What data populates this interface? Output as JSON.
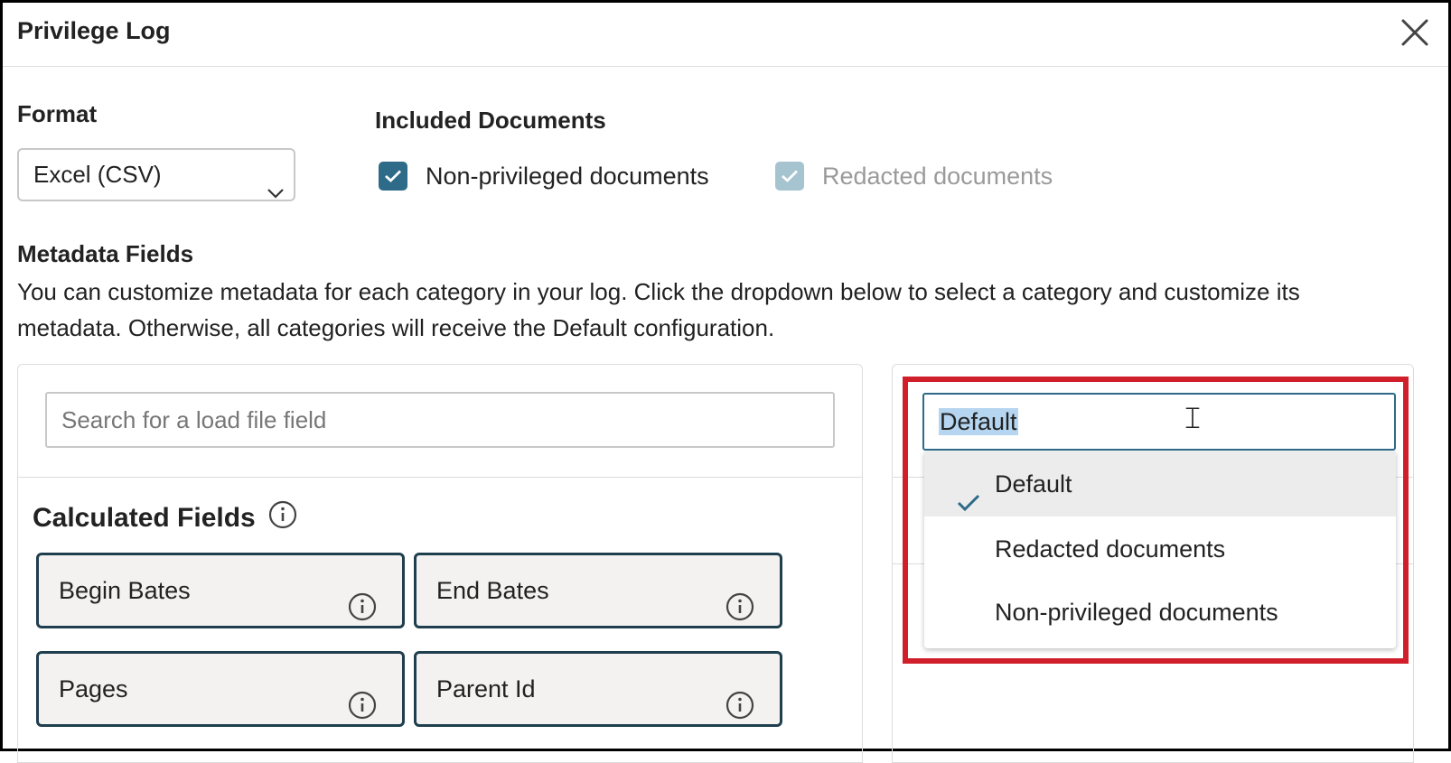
{
  "dialog": {
    "title": "Privilege Log",
    "close_icon": "close-icon"
  },
  "format": {
    "label": "Format",
    "selected": "Excel (CSV)",
    "icon": "chevron-down-icon"
  },
  "included_documents": {
    "label": "Included Documents",
    "options": [
      {
        "label": "Non-privileged documents",
        "checked": true,
        "disabled": false
      },
      {
        "label": "Redacted documents",
        "checked": true,
        "disabled": true
      }
    ]
  },
  "metadata": {
    "label": "Metadata Fields",
    "description": "You can customize metadata for each category in your log. Click the dropdown below to select a category and customize its metadata. Otherwise, all categories will receive the Default configuration."
  },
  "search": {
    "placeholder": "Search for a load file field"
  },
  "calculated_fields": {
    "title": "Calculated Fields",
    "fields": [
      "Begin Bates",
      "End Bates",
      "Pages",
      "Parent Id"
    ]
  },
  "category": {
    "value": "Default",
    "options": [
      {
        "label": "Default",
        "selected": true
      },
      {
        "label": "Redacted documents",
        "selected": false
      },
      {
        "label": "Non-privileged documents",
        "selected": false
      }
    ]
  },
  "colors": {
    "accent": "#2d6b88",
    "highlight": "#d01f2b",
    "field_border": "#1f3f4e"
  }
}
